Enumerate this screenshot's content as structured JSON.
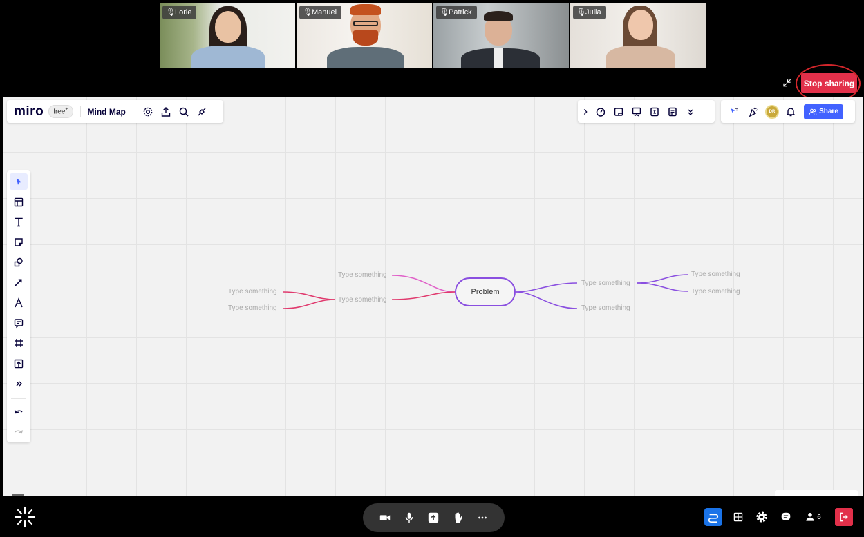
{
  "participants": [
    {
      "name": "Lorie",
      "muted": true
    },
    {
      "name": "Manuel",
      "muted": true
    },
    {
      "name": "Patrick",
      "muted": true
    },
    {
      "name": "Julia",
      "muted": true
    }
  ],
  "meeting": {
    "stop_sharing_label": "Stop sharing",
    "participant_count": "6",
    "accent_stop": "#e2304a"
  },
  "miro": {
    "logo": "miro",
    "plan": "free",
    "plan_mark": "+",
    "board_title": "Mind Map",
    "share_label": "Share",
    "avatar_initials": "DR",
    "accent": "#4262ff"
  },
  "mindmap": {
    "root": "Problem",
    "nodes": {
      "left_top": "Type something",
      "left_mid": "Type something",
      "left_leaf_1": "Type something",
      "left_leaf_2": "Type something",
      "right_top": "Type something",
      "right_bottom": "Type something",
      "right_leaf_1": "Type something",
      "right_leaf_2": "Type something"
    },
    "colors": {
      "left": "#e03a6e",
      "left_top": "#e060c8",
      "right": "#8a4fe0"
    }
  }
}
